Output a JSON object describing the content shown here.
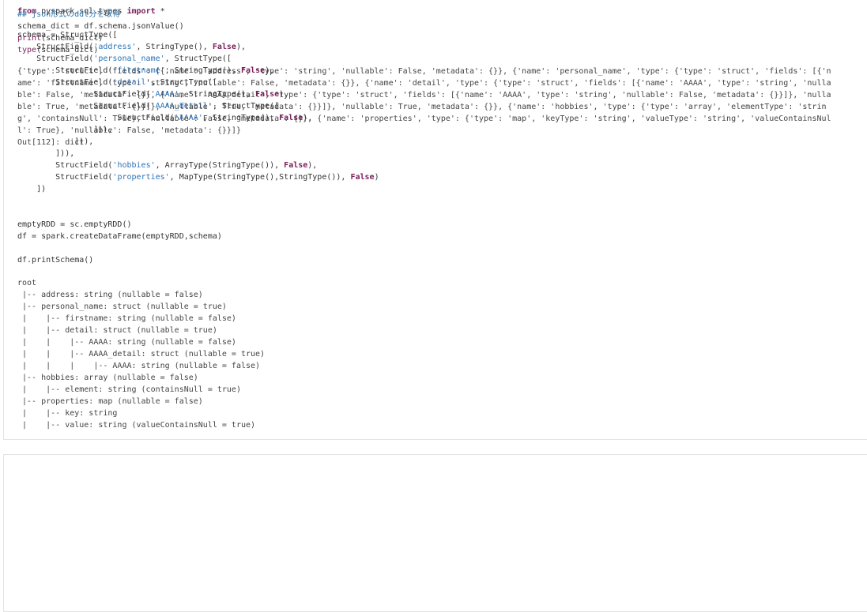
{
  "cell1": {
    "code": [
      [
        [
          "kw",
          "from"
        ],
        [
          "t",
          " pyspark.sql.types "
        ],
        [
          "kw",
          "import"
        ],
        [
          "t",
          " *"
        ]
      ],
      [],
      [
        [
          "t",
          "schema = StructType(["
        ]
      ],
      [
        [
          "t",
          "    StructField("
        ],
        [
          "str",
          "'address'"
        ],
        [
          "t",
          ", StringType(), "
        ],
        [
          "kw",
          "False"
        ],
        [
          "t",
          "),"
        ]
      ],
      [
        [
          "t",
          "    StructField("
        ],
        [
          "str",
          "'personal_name'"
        ],
        [
          "t",
          ", StructType(["
        ]
      ],
      [
        [
          "t",
          "        StructField("
        ],
        [
          "str",
          "'firstname'"
        ],
        [
          "t",
          ", StringType(), "
        ],
        [
          "kw",
          "False"
        ],
        [
          "t",
          "),"
        ]
      ],
      [
        [
          "t",
          "        StructField("
        ],
        [
          "str",
          "'detail'"
        ],
        [
          "t",
          ", StructType(["
        ]
      ],
      [
        [
          "t",
          "                StructField("
        ],
        [
          "str",
          "'AAAA'"
        ],
        [
          "t",
          ", StringType(), "
        ],
        [
          "kw",
          "False"
        ],
        [
          "t",
          "),"
        ]
      ],
      [
        [
          "t",
          "                StructField("
        ],
        [
          "str",
          "'AAAA_detail'"
        ],
        [
          "t",
          ", StructType(["
        ]
      ],
      [
        [
          "t",
          "                     StructField("
        ],
        [
          "str",
          "'AAAA'"
        ],
        [
          "t",
          ", StringType(), "
        ],
        [
          "kw",
          "False"
        ],
        [
          "t",
          "),"
        ]
      ],
      [
        [
          "t",
          "                ])),"
        ]
      ],
      [
        [
          "t",
          "            ])),"
        ]
      ],
      [
        [
          "t",
          "        ])),"
        ]
      ],
      [
        [
          "t",
          "        StructField("
        ],
        [
          "str",
          "'hobbies'"
        ],
        [
          "t",
          ", ArrayType(StringType()), "
        ],
        [
          "kw",
          "False"
        ],
        [
          "t",
          "),"
        ]
      ],
      [
        [
          "t",
          "        StructField("
        ],
        [
          "str",
          "'properties'"
        ],
        [
          "t",
          ", MapType(StringType(),StringType()), "
        ],
        [
          "kw",
          "False"
        ],
        [
          "t",
          ")"
        ]
      ],
      [
        [
          "t",
          "    ])"
        ]
      ],
      [],
      [],
      [
        [
          "t",
          "emptyRDD = sc.emptyRDD()"
        ]
      ],
      [
        [
          "t",
          "df = spark.createDataFrame(emptyRDD,schema)"
        ]
      ],
      [],
      [
        [
          "t",
          "df.printSchema()"
        ]
      ]
    ],
    "output": [
      "root",
      " |-- address: string (nullable = false)",
      " |-- personal_name: struct (nullable = true)",
      " |    |-- firstname: string (nullable = false)",
      " |    |-- detail: struct (nullable = true)",
      " |    |    |-- AAAA: string (nullable = false)",
      " |    |    |-- AAAA_detail: struct (nullable = true)",
      " |    |    |    |-- AAAA: string (nullable = false)",
      " |-- hobbies: array (nullable = false)",
      " |    |-- element: string (containsNull = true)",
      " |-- properties: map (nullable = false)",
      " |    |-- key: string",
      " |    |-- value: string (valueContainsNull = true)"
    ]
  },
  "cell2": {
    "code": [
      [
        [
          "cm",
          "## json形式のddl分を取得"
        ]
      ],
      [
        [
          "t",
          "schema_dict = df.schema.jsonValue()"
        ]
      ],
      [
        [
          "bi",
          "print"
        ],
        [
          "t",
          "(schema_dict)"
        ]
      ],
      [
        [
          "bi",
          "type"
        ],
        [
          "t",
          "(schema_dict)"
        ]
      ]
    ],
    "output": [
      "{'type': 'struct', 'fields': [{'name': 'address', 'type': 'string', 'nullable': False, 'metadata': {}}, {'name': 'personal_name', 'type': {'type': 'struct', 'fields': [{'n",
      "ame': 'firstname', 'type': 'string', 'nullable': False, 'metadata': {}}, {'name': 'detail', 'type': {'type': 'struct', 'fields': [{'name': 'AAAA', 'type': 'string', 'nulla",
      "ble': False, 'metadata': {}}, {'name': 'AAAA_detail', 'type': {'type': 'struct', 'fields': [{'name': 'AAAA', 'type': 'string', 'nullable': False, 'metadata': {}}]}, 'nulla",
      "ble': True, 'metadata': {}}]}, 'nullable': True, 'metadata': {}}]}, 'nullable': True, 'metadata': {}}, {'name': 'hobbies', 'type': {'type': 'array', 'elementType': 'strin",
      "g', 'containsNull': True}, 'nullable': False, 'metadata': {}}, {'name': 'properties', 'type': {'type': 'map', 'keyType': 'string', 'valueType': 'string', 'valueContainsNul",
      "l': True}, 'nullable': False, 'metadata': {}}]}",
      "Out[112]: dict"
    ]
  }
}
